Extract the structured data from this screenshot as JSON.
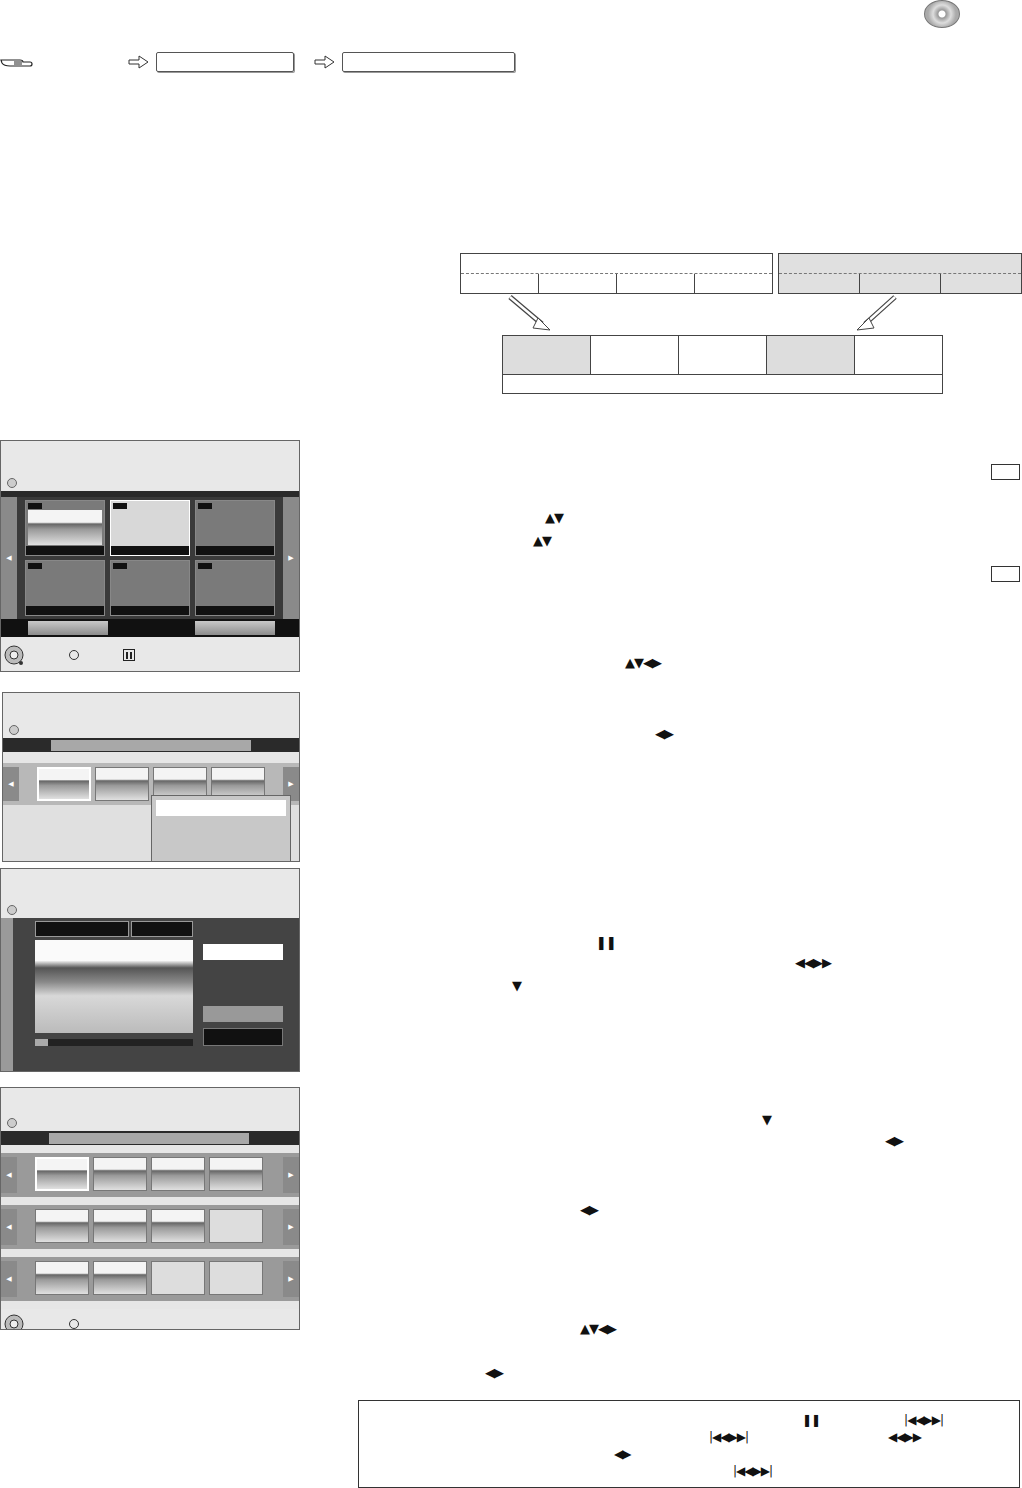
{
  "header": {
    "path": [
      "",
      ""
    ]
  },
  "diagram": {
    "source_a": {
      "title": "",
      "cells": [
        "",
        "",
        "",
        ""
      ]
    },
    "source_b": {
      "title": "",
      "cells": [
        "",
        "",
        ""
      ]
    },
    "result": {
      "cells": [
        {
          "text": "",
          "highlighted": true
        },
        {
          "text": "",
          "highlighted": false
        },
        {
          "text": "",
          "highlighted": false
        },
        {
          "text": "",
          "highlighted": true
        },
        {
          "text": "",
          "highlighted": false
        }
      ],
      "footer": ""
    }
  },
  "grid_screen": {
    "prev": "◀",
    "next": "▶",
    "thumbs": [
      {
        "kind": "photo",
        "selected": false
      },
      {
        "kind": "empty",
        "selected": true
      },
      {
        "kind": "empty",
        "selected": false
      },
      {
        "kind": "empty",
        "selected": false
      },
      {
        "kind": "empty",
        "selected": false
      },
      {
        "kind": "empty",
        "selected": false
      }
    ]
  },
  "menu_screen": {
    "prev": "◀",
    "next": "▶",
    "thumbs": [
      {
        "kind": "photo",
        "selected": true
      },
      {
        "kind": "photo",
        "selected": false
      },
      {
        "kind": "photo",
        "selected": false
      },
      {
        "kind": "photo",
        "selected": false
      }
    ],
    "menu_items": [
      {
        "text": "",
        "selected": true
      },
      {
        "text": "",
        "selected": false
      },
      {
        "text": "",
        "selected": false
      }
    ]
  },
  "player_screen": {
    "progress": 0.08,
    "buttons": [
      {
        "kind": "light"
      },
      {
        "kind": "none"
      },
      {
        "kind": "mid"
      },
      {
        "kind": "dark"
      }
    ]
  },
  "album_screen": {
    "prev": "◀",
    "next": "▶",
    "rows": [
      [
        {
          "kind": "photo",
          "selected": true
        },
        {
          "kind": "photo",
          "selected": false
        },
        {
          "kind": "photo",
          "selected": false
        },
        {
          "kind": "photo",
          "selected": false
        }
      ],
      [
        {
          "kind": "photo",
          "selected": false
        },
        {
          "kind": "photo",
          "selected": false
        },
        {
          "kind": "photo",
          "selected": false
        },
        {
          "kind": "empty",
          "selected": false
        }
      ],
      [
        {
          "kind": "photo",
          "selected": false
        },
        {
          "kind": "photo",
          "selected": false
        },
        {
          "kind": "empty",
          "selected": false
        },
        {
          "kind": "empty",
          "selected": false
        }
      ]
    ]
  },
  "marks": [
    {
      "kind": "box",
      "text": ""
    },
    {
      "kind": "glyph",
      "text": "▲▼"
    },
    {
      "kind": "glyph",
      "text": "▲▼"
    },
    {
      "kind": "box",
      "text": ""
    },
    {
      "kind": "glyph",
      "text": "▲▼◀▶"
    },
    {
      "kind": "glyph",
      "text": "◀▶"
    },
    {
      "kind": "glyph",
      "text": "❚❚"
    },
    {
      "kind": "glyph",
      "text": "◀◀▶▶"
    },
    {
      "kind": "glyph",
      "text": "▼"
    },
    {
      "kind": "glyph",
      "text": "▼"
    },
    {
      "kind": "glyph",
      "text": "◀▶"
    },
    {
      "kind": "glyph",
      "text": "◀▶"
    },
    {
      "kind": "glyph",
      "text": "▲▼◀▶"
    },
    {
      "kind": "glyph",
      "text": "◀▶"
    }
  ],
  "note": {
    "rows": [
      [
        "❚❚",
        "|◀◀▶▶|"
      ],
      [
        "|◀◀▶▶|",
        "◀◀▶▶"
      ],
      [
        "◀▶"
      ],
      [
        "|◀◀▶▶|"
      ]
    ]
  }
}
